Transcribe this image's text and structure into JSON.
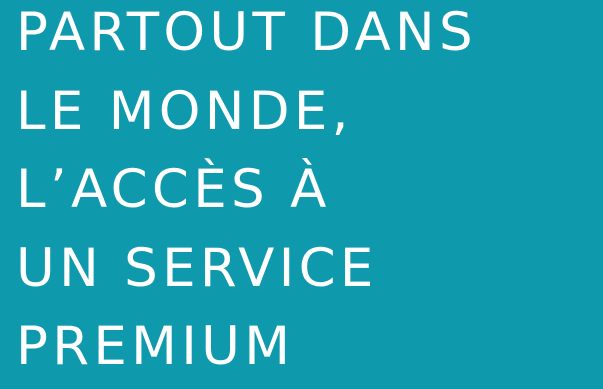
{
  "headline": {
    "lines": [
      "PARTOUT DANS",
      "LE MONDE,",
      "L’ACCÈS À",
      "UN SERVICE",
      "PREMIUM"
    ]
  },
  "colors": {
    "background": "#0e9aac",
    "text": "#ffffff"
  }
}
